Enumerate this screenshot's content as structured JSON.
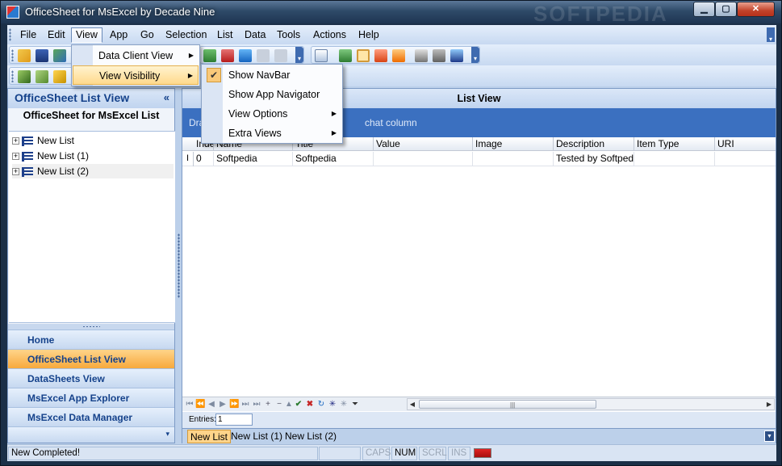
{
  "window": {
    "title": "OfficeSheet for MsExcel by Decade Nine",
    "watermark": "SOFTPEDIA",
    "minimize_label": "▁",
    "maximize_label": "▢",
    "close_label": "✕"
  },
  "menubar": {
    "items": [
      "File",
      "Edit",
      "View",
      "App",
      "Go",
      "Selection",
      "List",
      "Data",
      "Tools",
      "Actions",
      "Help"
    ],
    "active": "View"
  },
  "view_menu": {
    "items": [
      {
        "label": "Data Client View",
        "submenu": true
      },
      {
        "label": "View Visibility",
        "submenu": true
      }
    ]
  },
  "visibility_submenu": {
    "items": [
      {
        "label": "Show NavBar",
        "checked": true,
        "submenu": false
      },
      {
        "label": "Show App Navigator",
        "checked": false,
        "submenu": false
      },
      {
        "label": "View Options",
        "checked": false,
        "submenu": true
      },
      {
        "label": "Extra Views",
        "checked": false,
        "submenu": true
      }
    ]
  },
  "nav_panel": {
    "title": "OfficeSheet List View",
    "collapse_label": "«",
    "subtitle": "OfficeSheet for MsExcel List",
    "tree": [
      "New List",
      "New List (1)",
      "New List (2)"
    ],
    "buttons": [
      "Home",
      "OfficeSheet List View",
      "DataSheets View",
      "MsExcel App Explorer",
      "MsExcel Data Manager"
    ],
    "active_button": "OfficeSheet List View",
    "footer_arrow": "▾"
  },
  "main": {
    "title": "List View",
    "group_hint_start": "Dra",
    "group_hint_end": "chat column",
    "columns": [
      "Inde",
      "Name",
      "Title",
      "Value",
      "Image",
      "Description",
      "Item Type",
      "URI"
    ],
    "rows": [
      {
        "indicator": "I",
        "index": "0",
        "name": "Softpedia",
        "title": "Softpedia",
        "value": "",
        "image": "",
        "description": "Tested by Softpedia",
        "item_type": "",
        "uri": ""
      }
    ],
    "entries_label": "Entries:",
    "entries_value": "1"
  },
  "sheet_tabs": [
    "New List",
    "New List (1)",
    "New List (2)"
  ],
  "status": {
    "message": "New Completed!",
    "caps": "CAPS",
    "num": "NUM",
    "scrl": "SCRL",
    "ins": "INS"
  },
  "colors": {
    "accent": "#3b70c0",
    "active_nav": "#f7a93c",
    "header_text": "#15428b"
  }
}
